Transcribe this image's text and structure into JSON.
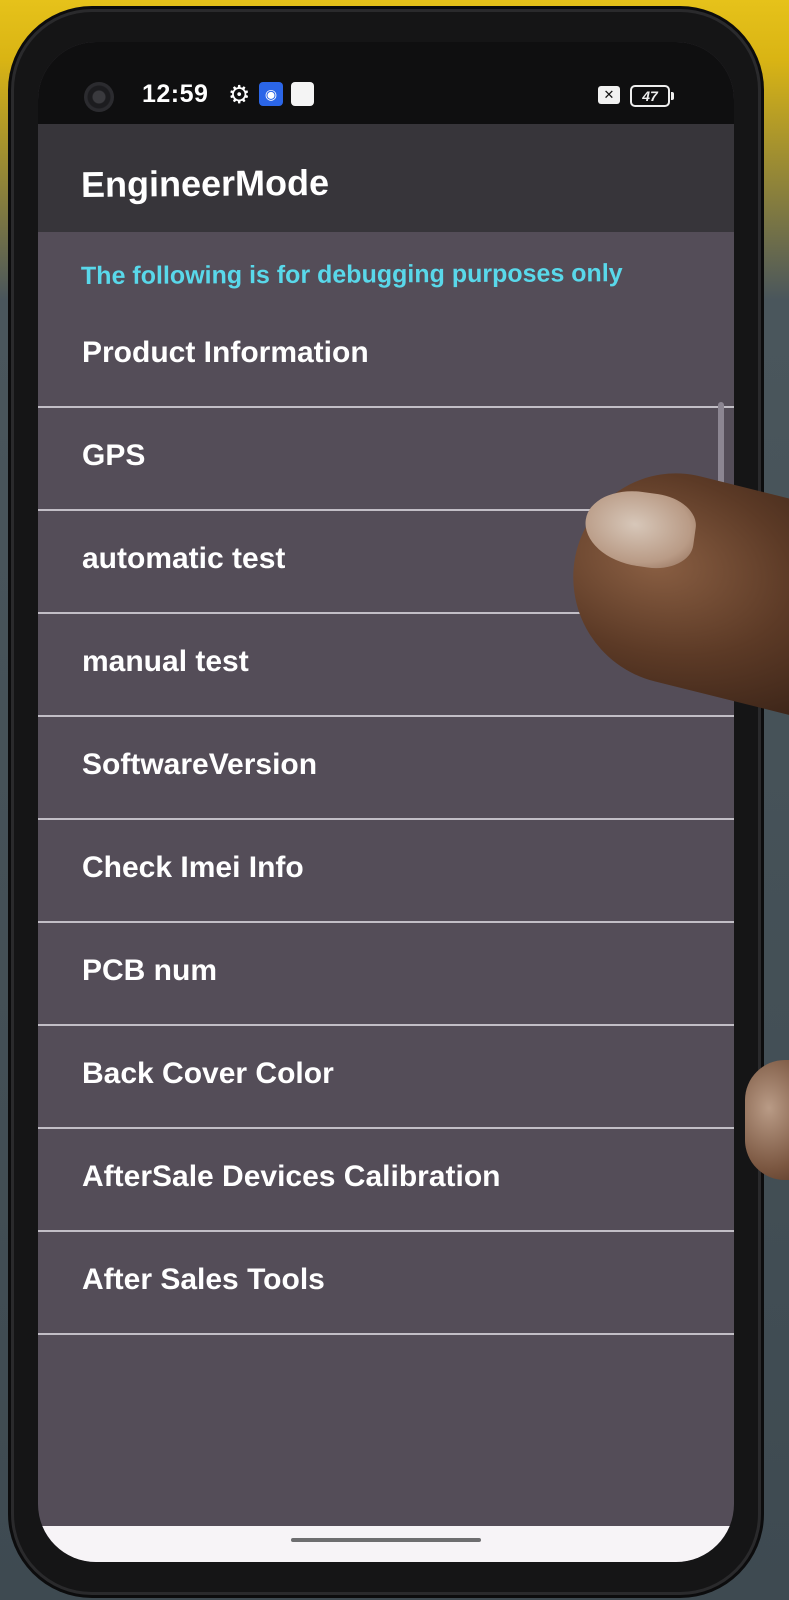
{
  "status_bar": {
    "time": "12:59",
    "battery_level": "47",
    "icons": [
      "settings-gear-icon",
      "hotspot-icon",
      "square-notification-icon",
      "no-sim-icon",
      "battery-icon"
    ]
  },
  "app": {
    "title": "EngineerMode",
    "notice": "The following is for debugging purposes only"
  },
  "menu": {
    "items": [
      {
        "label": "Product Information"
      },
      {
        "label": "GPS"
      },
      {
        "label": "automatic test"
      },
      {
        "label": "manual test"
      },
      {
        "label": "SoftwareVersion"
      },
      {
        "label": "Check Imei Info"
      },
      {
        "label": "PCB num"
      },
      {
        "label": "Back Cover Color"
      },
      {
        "label": "AfterSale Devices Calibration"
      },
      {
        "label": "After Sales Tools"
      }
    ]
  },
  "colors": {
    "background": "#544d58",
    "appbar": "#37353a",
    "notice_text": "#59d8ea",
    "divider": "#c2bec6"
  }
}
